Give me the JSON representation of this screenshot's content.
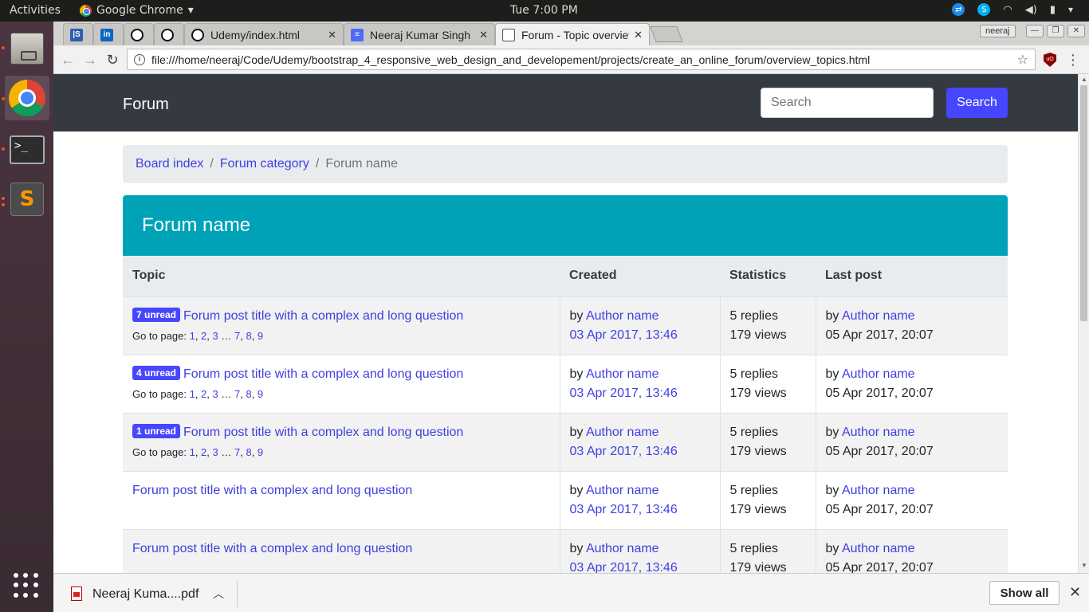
{
  "os": {
    "activities": "Activities",
    "app_name": "Google Chrome",
    "clock": "Tue  7:00 PM"
  },
  "browser": {
    "tabs": [
      {
        "label": "",
        "icon": "udemy-icon"
      },
      {
        "label": "",
        "icon": "linkedin-icon"
      },
      {
        "label": "",
        "icon": "github-icon"
      },
      {
        "label": "",
        "icon": "github-icon"
      },
      {
        "label": "Udemy/index.html",
        "icon": "github-icon"
      },
      {
        "label": "Neeraj Kumar Singh",
        "icon": "document-icon"
      },
      {
        "label": "Forum - Topic overview",
        "icon": "page-icon",
        "active": true
      }
    ],
    "user": "neeraj",
    "url": "file:///home/neeraj/Code/Udemy/bootstrap_4_responsive_web_design_and_developement/projects/create_an_online_forum/overview_topics.html"
  },
  "page": {
    "brand": "Forum",
    "search_placeholder": "Search",
    "search_button": "Search",
    "breadcrumb": {
      "board_index": "Board index",
      "forum_category": "Forum category",
      "current": "Forum name",
      "separator": "/"
    },
    "panel_title": "Forum name",
    "table": {
      "headers": {
        "topic": "Topic",
        "created": "Created",
        "statistics": "Statistics",
        "last_post": "Last post"
      },
      "rows": [
        {
          "badge": "7 unread",
          "title": "Forum post title with a complex and long question",
          "goto": "Go to page:",
          "pages": [
            "1",
            "2",
            "3",
            "7",
            "8",
            "9"
          ],
          "by": "by",
          "author": "Author name",
          "created": "03 Apr 2017, 13:46",
          "replies": "5 replies",
          "views": "179 views",
          "last_by": "by",
          "last_author": "Author name",
          "last_date": "05 Apr 2017, 20:07"
        },
        {
          "badge": "4 unread",
          "title": "Forum post title with a complex and long question",
          "goto": "Go to page:",
          "pages": [
            "1",
            "2",
            "3",
            "7",
            "8",
            "9"
          ],
          "by": "by",
          "author": "Author name",
          "created": "03 Apr 2017, 13:46",
          "replies": "5 replies",
          "views": "179 views",
          "last_by": "by",
          "last_author": "Author name",
          "last_date": "05 Apr 2017, 20:07"
        },
        {
          "badge": "1 unread",
          "title": "Forum post title with a complex and long question",
          "goto": "Go to page:",
          "pages": [
            "1",
            "2",
            "3",
            "7",
            "8",
            "9"
          ],
          "by": "by",
          "author": "Author name",
          "created": "03 Apr 2017, 13:46",
          "replies": "5 replies",
          "views": "179 views",
          "last_by": "by",
          "last_author": "Author name",
          "last_date": "05 Apr 2017, 20:07"
        },
        {
          "title": "Forum post title with a complex and long question",
          "by": "by",
          "author": "Author name",
          "created": "03 Apr 2017, 13:46",
          "replies": "5 replies",
          "views": "179 views",
          "last_by": "by",
          "last_author": "Author name",
          "last_date": "05 Apr 2017, 20:07"
        },
        {
          "title": "Forum post title with a complex and long question",
          "by": "by",
          "author": "Author name",
          "created": "03 Apr 2017, 13:46",
          "replies": "5 replies",
          "views": "179 views",
          "last_by": "by",
          "last_author": "Author name",
          "last_date": "05 Apr 2017, 20:07"
        }
      ]
    }
  },
  "downloads": {
    "file": "Neeraj Kuma....pdf",
    "show_all": "Show all"
  },
  "colors": {
    "navbar": "#343a40",
    "primary": "#4646ff",
    "panel": "#00a2b8",
    "link": "#3f3fe0"
  }
}
